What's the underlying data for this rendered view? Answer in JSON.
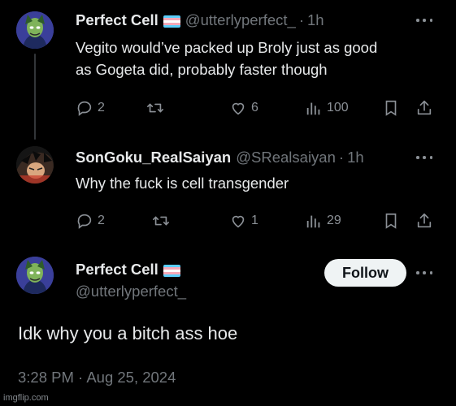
{
  "tweets": [
    {
      "display_name": "Perfect Cell",
      "handle": "@utterlyperfect_",
      "separator": "·",
      "time": "1h",
      "text_lines": [
        "Vegito would’ve packed up Broly just as good",
        "as Gogeta did, probably faster though"
      ],
      "replies": "2",
      "likes": "6",
      "views": "100"
    },
    {
      "display_name": "SonGoku_RealSaiyan",
      "handle": "@SRealsaiyan",
      "separator": "·",
      "time": "1h",
      "text_lines": [
        "Why the fuck is cell transgender"
      ],
      "replies": "2",
      "likes": "1",
      "views": "29"
    }
  ],
  "main_post": {
    "display_name": "Perfect Cell",
    "handle": "@utterlyperfect_",
    "follow_label": "Follow",
    "text": "Idk why you a bitch ass hoe",
    "timestamp": "3:28 PM · Aug 25, 2024"
  },
  "watermark": "imgflip.com",
  "icons": {
    "reply": "reply-icon",
    "retweet": "retweet-icon",
    "like": "like-icon",
    "views": "views-icon",
    "bookmark": "bookmark-icon",
    "share": "share-icon",
    "more": "more-icon",
    "flag": "transgender-flag-icon"
  },
  "colors": {
    "background": "#000000",
    "text": "#e7e9ea",
    "muted": "#71767b",
    "icon": "#8b9096",
    "follow_bg": "#eff3f4",
    "flag_blue": "#5bcefa",
    "flag_pink": "#f5a9b8",
    "flag_white": "#ffffff"
  }
}
